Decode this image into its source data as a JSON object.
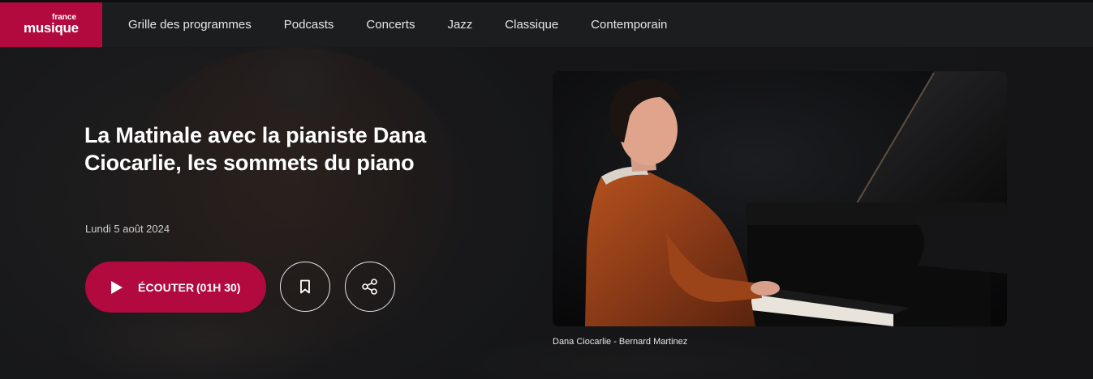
{
  "header": {
    "logo_top": "france",
    "logo_main": "musique",
    "nav": [
      "Grille des programmes",
      "Podcasts",
      "Concerts",
      "Jazz",
      "Classique",
      "Contemporain"
    ]
  },
  "episode": {
    "title": "La Matinale avec la pianiste Dana Ciocarlie, les sommets du piano",
    "date": "Lundi 5 août 2024",
    "listen_label": "ÉCOUTER",
    "listen_duration": "(01H 30)"
  },
  "photo": {
    "caption": "Dana Ciocarlie - Bernard Martinez"
  },
  "icons": {
    "play": "play-icon",
    "bookmark": "bookmark-icon",
    "share": "share-icon"
  },
  "colors": {
    "brand": "#b20a3f",
    "background": "#1a1b1d",
    "header": "#1c1d1f"
  }
}
